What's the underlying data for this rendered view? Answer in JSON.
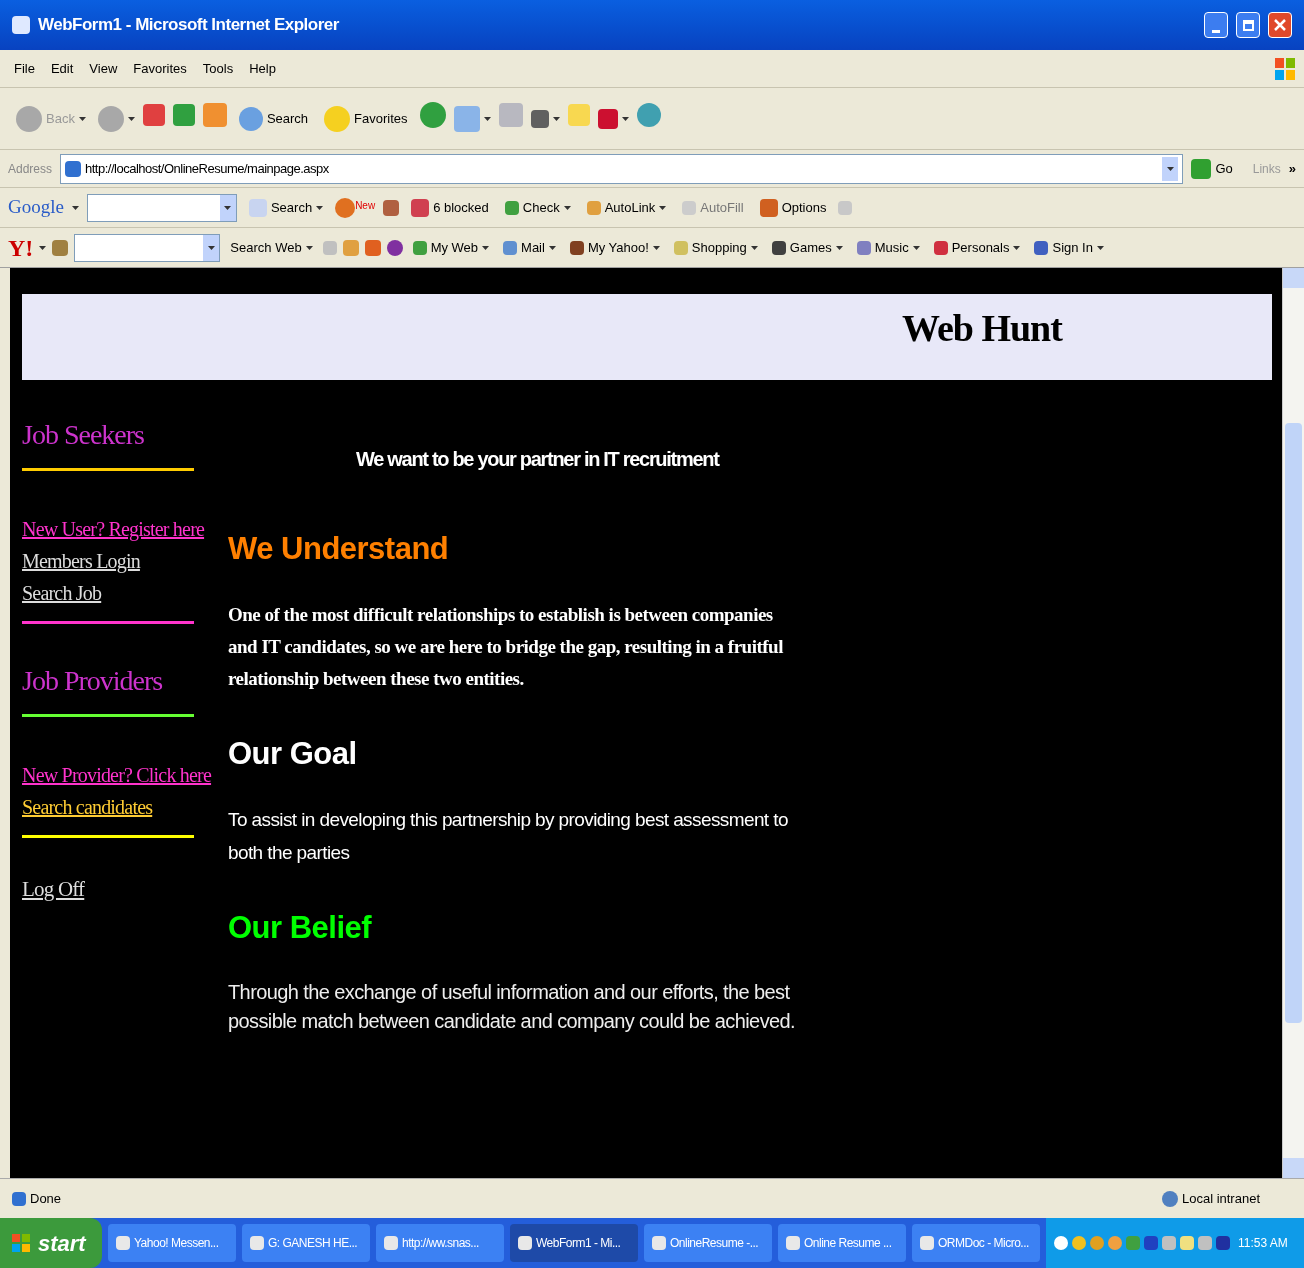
{
  "window": {
    "title": "WebForm1 - Microsoft Internet Explorer"
  },
  "menu": [
    "File",
    "Edit",
    "View",
    "Favorites",
    "Tools",
    "Help"
  ],
  "toolbar": {
    "back": "Back",
    "search": "Search",
    "favorites": "Favorites"
  },
  "address": {
    "label": "Address",
    "url": "http://localhost/OnlineResume/mainpage.aspx",
    "go": "Go",
    "links": "Links",
    "more": "»"
  },
  "google_bar": {
    "logo": "Google",
    "search": "Search",
    "new_badge": "New",
    "blocked": "6 blocked",
    "check": "Check",
    "autolink": "AutoLink",
    "autofill": "AutoFill",
    "options": "Options"
  },
  "yahoo_bar": {
    "logo": "Y!",
    "search": "Search Web",
    "items": [
      "My Web",
      "Mail",
      "My Yahoo!",
      "Shopping",
      "Games",
      "Music",
      "Personals",
      "Sign In"
    ]
  },
  "page": {
    "banner_title": "Web Hunt",
    "sidebar": [
      {
        "heading": {
          "text": "Job Seekers",
          "color": "#cc33cc"
        },
        "rule": {
          "color": "#ffcc00"
        },
        "links": [
          {
            "text": "New User? Register here",
            "color": "#ff33cc"
          },
          {
            "text": "Members Login",
            "color": "#dddddd"
          },
          {
            "text": "Search Job",
            "color": "#dddddd"
          }
        ],
        "end_rule": {
          "color": "#ff33cc"
        }
      },
      {
        "heading": {
          "text": "Job Providers",
          "color": "#cc33cc"
        },
        "rule": {
          "color": "#66ff33"
        },
        "links": [
          {
            "text": "New Provider? Click here",
            "color": "#ff33cc"
          },
          {
            "text": "Search candidates",
            "color": "#ffcc33"
          }
        ],
        "end_rule": {
          "color": "#ffff00"
        }
      }
    ],
    "logoff": {
      "text": "Log Off",
      "color": "#dddddd"
    },
    "tagline": "We want to be your partner in IT recruitment",
    "sections": [
      {
        "heading": "We Understand",
        "color": "#ff8000",
        "kind": "serif",
        "body": "One of the most difficult relationships to establish is between companies and IT candidates, so we are here to bridge the gap, resulting in a fruitful relationship between these two entities."
      },
      {
        "heading": "Our Goal",
        "color": "#ffffff",
        "kind": "sans",
        "body": "To assist in developing this partnership by providing best assessment to both the parties"
      },
      {
        "heading": "Our Belief",
        "color": "#00ff00",
        "kind": "light",
        "body": "Through the exchange of useful information and our efforts, the best possible match between candidate and company could be achieved."
      }
    ]
  },
  "status_bar": {
    "text": "Done",
    "zone": "Local intranet"
  },
  "taskbar": {
    "start": "start",
    "items": [
      {
        "label": "Yahoo! Messen...",
        "selected": false
      },
      {
        "label": "G: GANESH HE...",
        "selected": false
      },
      {
        "label": "http://ww.snas...",
        "selected": false
      },
      {
        "label": "WebForm1 - Mi...",
        "selected": true
      },
      {
        "label": "OnlineResume -...",
        "selected": false
      },
      {
        "label": "Online Resume ...",
        "selected": false
      },
      {
        "label": "ORMDoc - Micro...",
        "selected": false
      }
    ],
    "clock": "11:53 AM"
  }
}
